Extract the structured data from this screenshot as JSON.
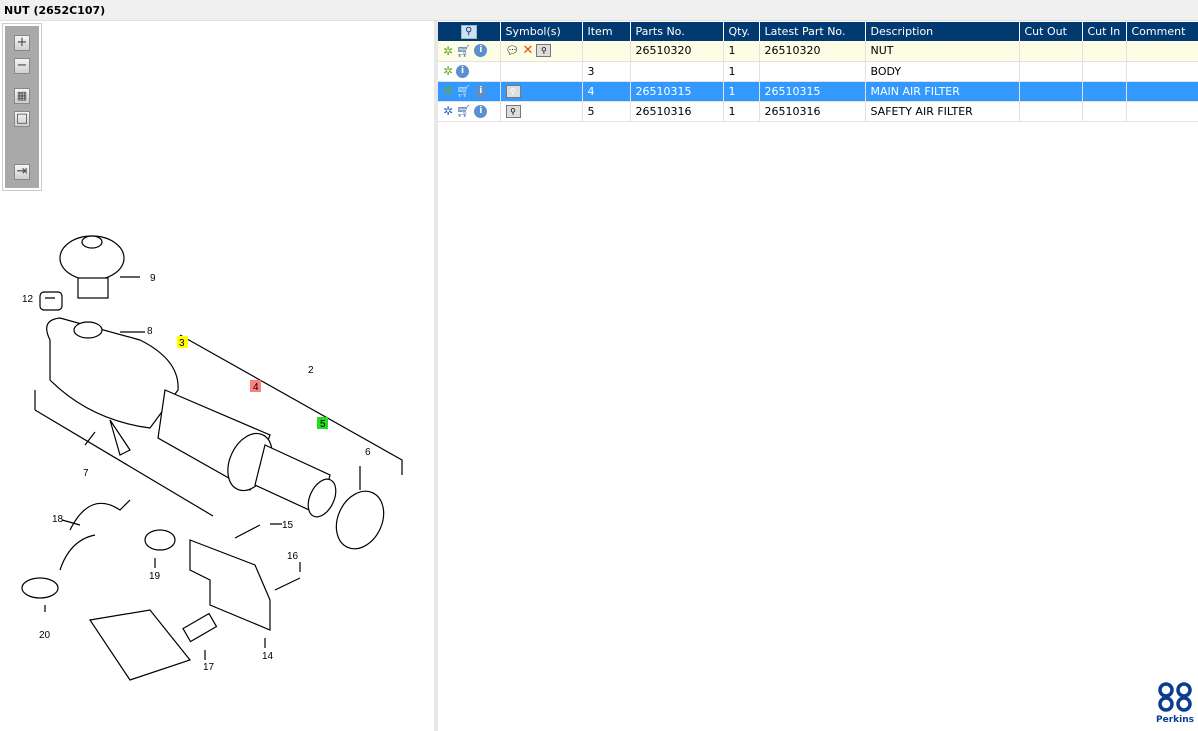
{
  "window": {
    "title": "NUT (2652C107)"
  },
  "toolbar": {
    "zoom_in": "+",
    "zoom_out": "−",
    "fit": "▦",
    "actual": "□",
    "export": "⇥"
  },
  "grid": {
    "columns": [
      "",
      "Symbol(s)",
      "Item",
      "Parts No.",
      "Qty.",
      "Latest Part No.",
      "Description",
      "Cut Out",
      "Cut In",
      "Comment"
    ],
    "rows": [
      {
        "item": "",
        "parts_no": "26510320",
        "qty": "1",
        "latest": "26510320",
        "description": "NUT",
        "cut_out": "",
        "cut_in": "",
        "comment": "",
        "symbols": [
          "note",
          "delete",
          "book"
        ],
        "selected": false
      },
      {
        "item": "3",
        "parts_no": "",
        "qty": "1",
        "latest": "",
        "description": "BODY",
        "cut_out": "",
        "cut_in": "",
        "comment": "",
        "symbols": [],
        "selected": false
      },
      {
        "item": "4",
        "parts_no": "26510315",
        "qty": "1",
        "latest": "26510315",
        "description": "MAIN AIR FILTER",
        "cut_out": "",
        "cut_in": "",
        "comment": "",
        "symbols": [
          "book"
        ],
        "selected": true
      },
      {
        "item": "5",
        "parts_no": "26510316",
        "qty": "1",
        "latest": "26510316",
        "description": "SAFETY AIR FILTER",
        "cut_out": "",
        "cut_in": "",
        "comment": "",
        "symbols": [
          "book"
        ],
        "selected": false
      }
    ]
  },
  "diagram": {
    "callouts": [
      "9",
      "12",
      "8",
      "3",
      "2",
      "4",
      "5",
      "6",
      "7",
      "18",
      "15",
      "16",
      "19",
      "20",
      "14",
      "17"
    ],
    "highlight_colors": {
      "3": "#ffff00",
      "4": "#ff7f7f",
      "5": "#22dd22"
    }
  },
  "logo": {
    "text": "Perkins"
  }
}
